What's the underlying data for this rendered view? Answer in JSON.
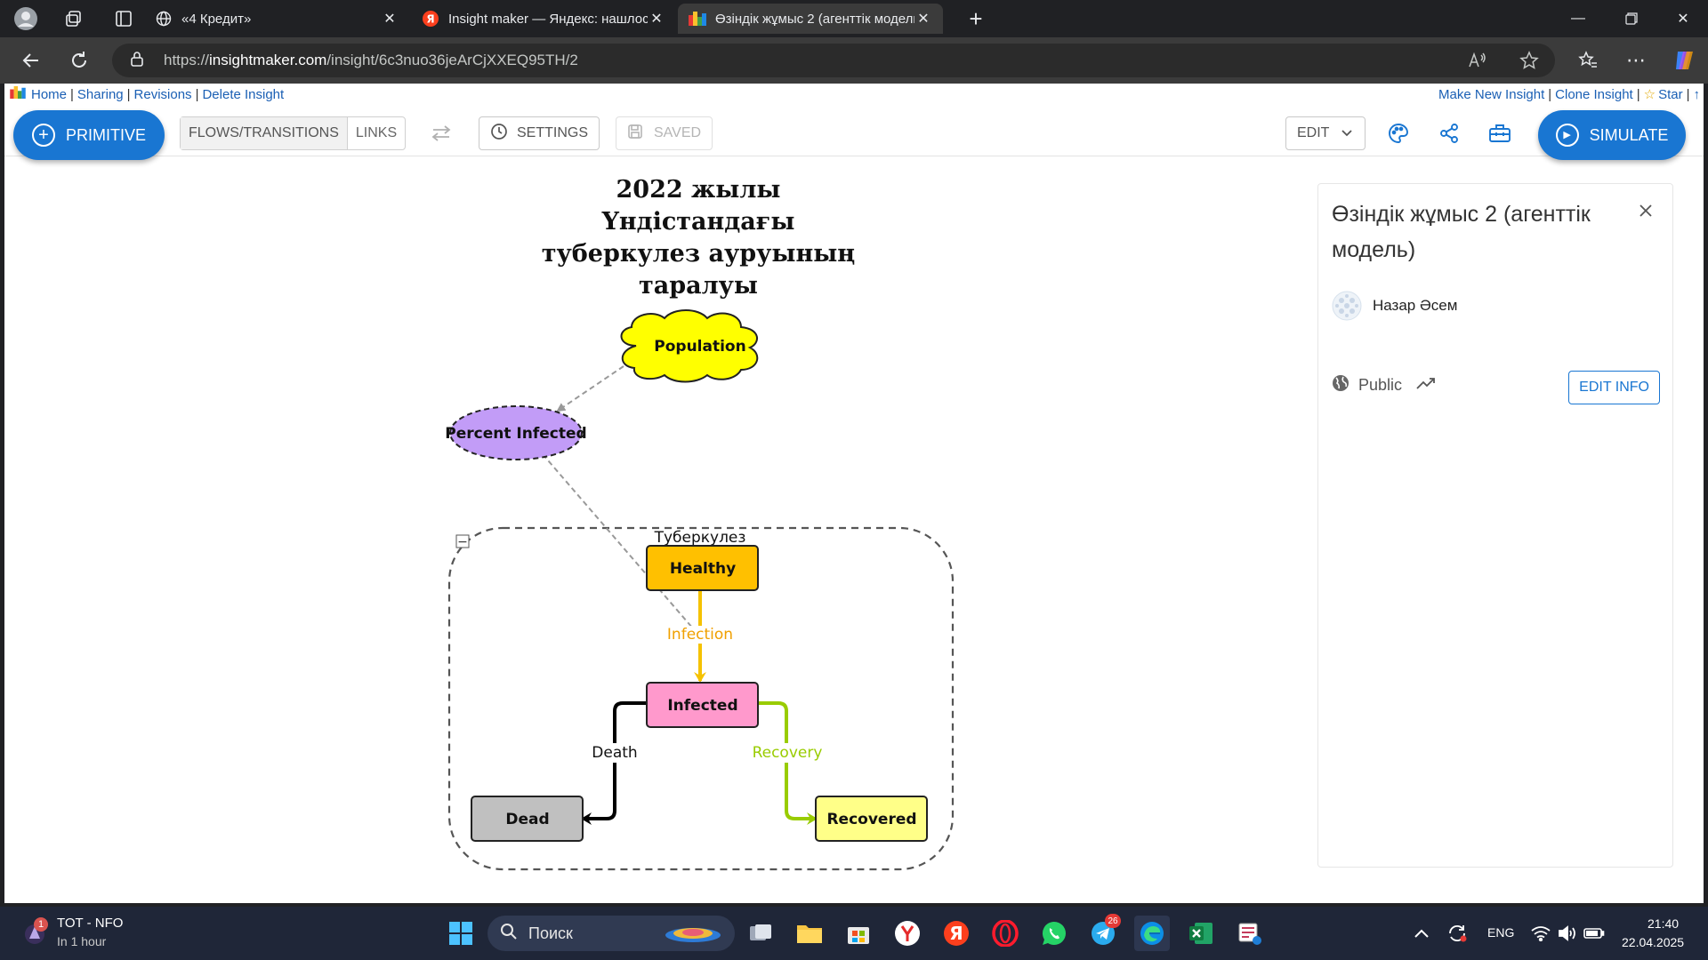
{
  "browser": {
    "tabs": [
      {
        "title": "«4 Кредит»",
        "active": false
      },
      {
        "title": "Insight maker — Яндекс: нашлось",
        "active": false
      },
      {
        "title": "Өзіндік жұмыс 2 (агенттік модель)",
        "active": true
      }
    ],
    "url_scheme": "https://",
    "url_host": "insightmaker.com",
    "url_path": "/insight/6c3nuo36jeArCjXXEQ95TH/2"
  },
  "site_nav": {
    "left": [
      "Home",
      "Sharing",
      "Revisions",
      "Delete Insight"
    ],
    "right": [
      "Make New Insight",
      "Clone Insight",
      "Star"
    ]
  },
  "toolbar": {
    "primitive_label": "PRIMITIVE",
    "flows_label": "FLOWS/TRANSITIONS",
    "links_label": "LINKS",
    "settings_label": "SETTINGS",
    "saved_label": "SAVED",
    "edit_label": "EDIT",
    "simulate_label": "SIMULATE"
  },
  "diagram": {
    "title_lines": [
      "2022 жылы Үндістандағы",
      "туберкулез ауруының",
      "таралуы"
    ],
    "population_label": "Population",
    "percent_infected_label": "Percent Infected",
    "folder_label": "Туберкулез",
    "healthy_label": "Healthy",
    "infected_label": "Infected",
    "dead_label": "Dead",
    "recovered_label": "Recovered",
    "infection_label": "Infection",
    "death_label": "Death",
    "recovery_label": "Recovery",
    "collapse_glyph": "−"
  },
  "info_panel": {
    "title": "Өзіндік жұмыс 2 (агенттік модель)",
    "author": "Назар Әсем",
    "visibility": "Public",
    "edit_info_label": "EDIT INFO"
  },
  "taskbar": {
    "notif_title": "TOT - NFO",
    "notif_sub": "In 1 hour",
    "notif_badge": "1",
    "search_label": "Поиск",
    "telegram_badge": "26",
    "lang": "ENG",
    "time": "21:40",
    "date": "22.04.2025"
  },
  "colors": {
    "accent": "#1976d2",
    "population": "#ffff00",
    "percent_infected": "#c29cf7",
    "healthy": "#ffc000",
    "infected": "#ff99cc",
    "dead": "#c0c0c0",
    "recovered": "#ffff88",
    "infection_flow": "#f5c200",
    "recovery_flow": "#99cc00"
  }
}
